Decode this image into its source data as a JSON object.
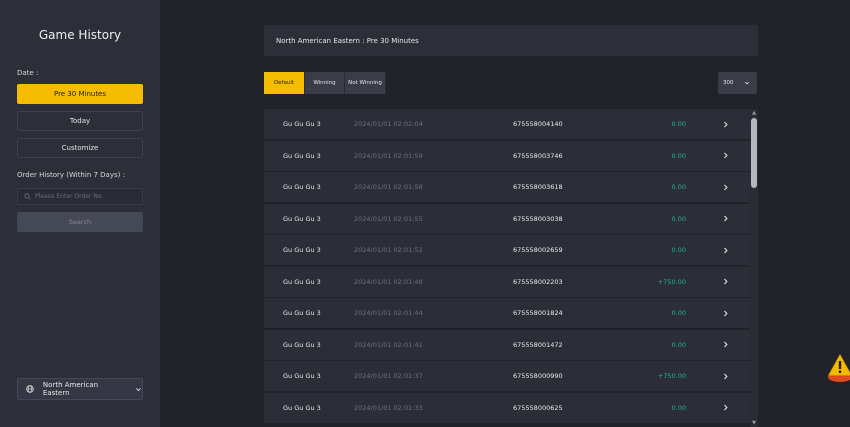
{
  "sidebar": {
    "title": "Game History",
    "date_label": "Date :",
    "date_options": [
      "Pre 30 Minutes",
      "Today",
      "Customize"
    ],
    "order_history_label": "Order History (Within 7 Days) :",
    "search_placeholder": "Please Enter Order No.",
    "search_button": "Search",
    "region": "North American Eastern",
    "icons": {
      "search": "search-icon",
      "globe": "globe-icon",
      "chevron": "chevron-down-icon"
    }
  },
  "header": {
    "title": "North American Eastern : Pre 30 Minutes"
  },
  "filters": {
    "tabs": [
      "Default",
      "Winning",
      "Not Winning"
    ],
    "active": "Default",
    "page_size": "300"
  },
  "rows": [
    {
      "game": "Gu Gu Gu 3",
      "time": "2024/01/01 02:02:04",
      "order": "675558004140",
      "amount": "0.00"
    },
    {
      "game": "Gu Gu Gu 3",
      "time": "2024/01/01 02:01:59",
      "order": "675558003746",
      "amount": "0.00"
    },
    {
      "game": "Gu Gu Gu 3",
      "time": "2024/01/01 02:01:58",
      "order": "675558003618",
      "amount": "0.00"
    },
    {
      "game": "Gu Gu Gu 3",
      "time": "2024/01/01 02:01:55",
      "order": "675558003038",
      "amount": "0.00"
    },
    {
      "game": "Gu Gu Gu 3",
      "time": "2024/01/01 02:01:52",
      "order": "675558002659",
      "amount": "0.00"
    },
    {
      "game": "Gu Gu Gu 3",
      "time": "2024/01/01 02:01:48",
      "order": "675558002203",
      "amount": "+750.00"
    },
    {
      "game": "Gu Gu Gu 3",
      "time": "2024/01/01 02:01:44",
      "order": "675558001824",
      "amount": "0.00"
    },
    {
      "game": "Gu Gu Gu 3",
      "time": "2024/01/01 02:01:41",
      "order": "675558001472",
      "amount": "0.00"
    },
    {
      "game": "Gu Gu Gu 3",
      "time": "2024/01/01 02:01:37",
      "order": "675558000990",
      "amount": "+750.00"
    },
    {
      "game": "Gu Gu Gu 3",
      "time": "2024/01/01 02:01:33",
      "order": "675558000625",
      "amount": "0.00"
    }
  ],
  "colors": {
    "accent": "#f5bc00",
    "amount": "#21b38f",
    "background": "#21232b",
    "panel": "#2d2f38"
  }
}
